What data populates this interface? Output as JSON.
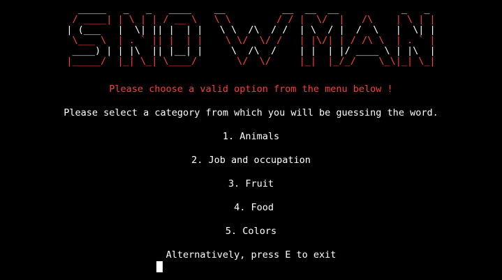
{
  "banner": {
    "rows": [
      "  _____   _   _   ____    __          __  __  __           _   _ ",
      " / ____| | \\ | | / __ \\   \\ \\        / / |  \\/  |   /\\    | \\ | |",
      "| (___   |  \\| || |  | |   \\ \\  /\\  / /  | \\  / |  /  \\   |  \\| |",
      " \\___ \\  | . ` || |  | |    \\ \\/  \\/ /   | |\\/| | / /\\ \\  | . ` |",
      " ____) | | |\\  || |__| |     \\  /\\  /    | |  | |/ ____ \\ | |\\  |",
      "|_____/  |_| \\_| \\____/       \\/  \\/     |_|  |_/_/    \\_\\|_| \\_|"
    ],
    "colors": [
      "#ffffff",
      "#ff4040",
      "#ffffff",
      "#ff4040",
      "#ffffff",
      "#ff4040"
    ]
  },
  "messages": {
    "error": "Please choose a valid option from the menu below !",
    "prompt": "Please select a category from which you will be guessing the word.",
    "alternative": "Alternatively, press E to exit"
  },
  "menu": {
    "options": [
      "1. Animals",
      "2. Job and occupation",
      "3. Fruit",
      " 4. Food",
      "5. Colors"
    ]
  },
  "colors": {
    "background": "#000000",
    "text": "#ffffff",
    "error": "#ff3b3b"
  }
}
